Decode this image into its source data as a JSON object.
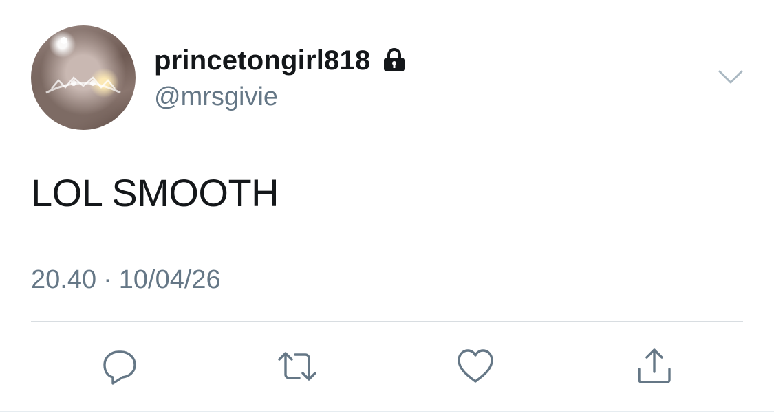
{
  "tweet": {
    "author": {
      "display_name": "princetongirl818",
      "handle": "@mrsgivie",
      "protected": true
    },
    "text": "LOL SMOOTH",
    "time": "20.40",
    "separator": "·",
    "date": "10/04/26"
  },
  "actions": {
    "reply_icon": "reply-icon",
    "retweet_icon": "retweet-icon",
    "like_icon": "heart-icon",
    "share_icon": "share-icon"
  },
  "colors": {
    "primary_text": "#14171a",
    "secondary_text": "#657786",
    "icon": "#657786",
    "divider": "#d8dde1"
  }
}
